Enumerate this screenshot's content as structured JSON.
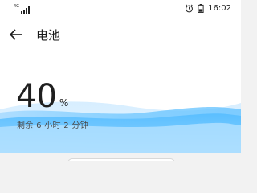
{
  "status_bar": {
    "network_label": "4G",
    "signal_icon": "signal-icon",
    "alarm_icon": "alarm-icon",
    "battery_icon": "battery-icon",
    "time": "16:02"
  },
  "header": {
    "back_icon": "arrow-left-icon",
    "title": "电池"
  },
  "battery": {
    "level_percent": 40,
    "percent_value": "40",
    "percent_sign": "%",
    "remaining_text": "剩余 6 小时 2 分钟",
    "wave_colors": [
      "#c9e7ff",
      "#8fd0ff",
      "#5ec3ff"
    ]
  },
  "colors": {
    "background": "#f2f2f2",
    "surface": "#ffffff",
    "accent": "#45b6ff"
  }
}
